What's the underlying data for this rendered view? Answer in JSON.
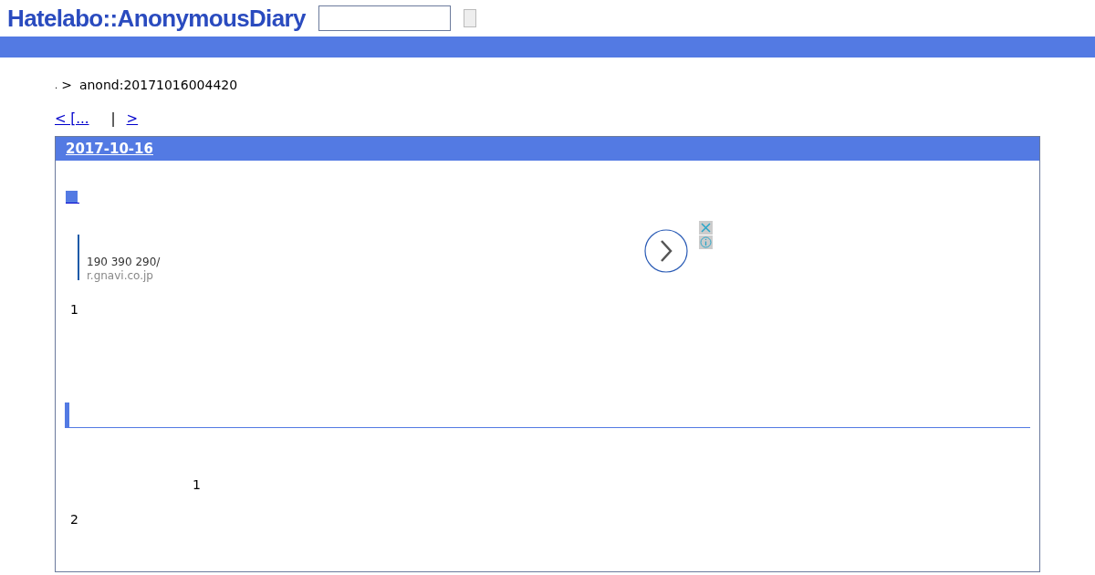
{
  "header": {
    "logo": "Hatelabo::AnonymousDiary"
  },
  "breadcrumb": {
    "home": ".",
    "separator": ">",
    "current": "anond:20171016004420"
  },
  "pager": {
    "prev": "< [...",
    "divider": "|",
    "next": ">"
  },
  "day": {
    "date": "2017-10-16",
    "ad": {
      "line_1": "190 390 290/",
      "line_2": "r.gnavi.co.jp"
    },
    "paragraph_1": "1",
    "paragraph_2": "1",
    "paragraph_3": "2"
  }
}
